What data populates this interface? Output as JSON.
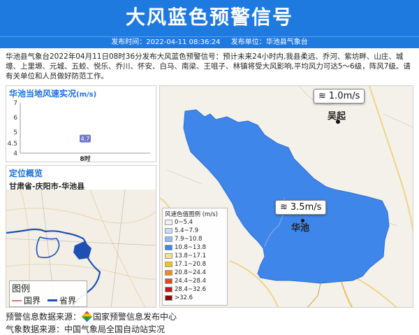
{
  "header": {
    "title": "大风蓝色预警信号",
    "release_time_label": "发布时间：2022-04-11 08:36:24",
    "issuer_label": "发布单位：华池县气象台"
  },
  "description": "华池县气象台2022年04月11日08时36分发布大风蓝色预警信号：预计未来24小时内,我县柔远、乔河、紫坊畔、山庄、城壕、上里塬、元城、五蛟、悦乐、乔川、怀安、白马、南梁、王咀子、林镇将受大风影响,平均风力可达5～6级，阵风7级。请有关单位和人员做好防范工作。",
  "wind_panel": {
    "title": "华池当地风速实况",
    "unit": "(m/s)"
  },
  "chart_data": {
    "type": "scatter",
    "categories": [
      "8时"
    ],
    "values": [
      4.7
    ],
    "ylim": [
      4,
      7
    ],
    "yticks": [
      "7",
      "6",
      "5",
      "4.5",
      "4"
    ],
    "point_label": "4.7",
    "point_color": "#6f77c9"
  },
  "location_panel": {
    "title": "定位概览",
    "path": "甘肃省-庆阳市-华池县"
  },
  "small_map_legend": {
    "title": "图例",
    "national_border": "国界",
    "provincial_border": "省界",
    "national_color": "#d07a7a",
    "provincial_color": "#1e4fb5"
  },
  "main_map": {
    "tag_wuqi_speed": "1.0m/s",
    "tag_huachi_speed": "3.5m/s",
    "city_wuqi": "吴起",
    "city_huachi": "华池",
    "region_color": "#3f86ea"
  },
  "wind_legend": {
    "title": "风速色值图例 (m/s)",
    "items": [
      {
        "label": "0~5.4",
        "color": "#f2f2f2"
      },
      {
        "label": "5.4~7.9",
        "color": "#c5ddf6"
      },
      {
        "label": "7.9~10.8",
        "color": "#8fbcef"
      },
      {
        "label": "10.8~13.8",
        "color": "#3f86ea"
      },
      {
        "label": "13.8~17.1",
        "color": "#f7e27a"
      },
      {
        "label": "17.1~20.8",
        "color": "#f6c41f"
      },
      {
        "label": "20.8~24.4",
        "color": "#f08a1b"
      },
      {
        "label": "24.4~28.4",
        "color": "#e04a1a"
      },
      {
        "label": "28.4~32.6",
        "color": "#c81414"
      },
      {
        "label": ">32.6",
        "color": "#8a0a0a"
      }
    ]
  },
  "footer": {
    "source_label": "预警信息数据来源：",
    "source_name": "国家预警信息发布中心",
    "weather_source": "气象数据来源：中国气象局全国自动站实况"
  }
}
